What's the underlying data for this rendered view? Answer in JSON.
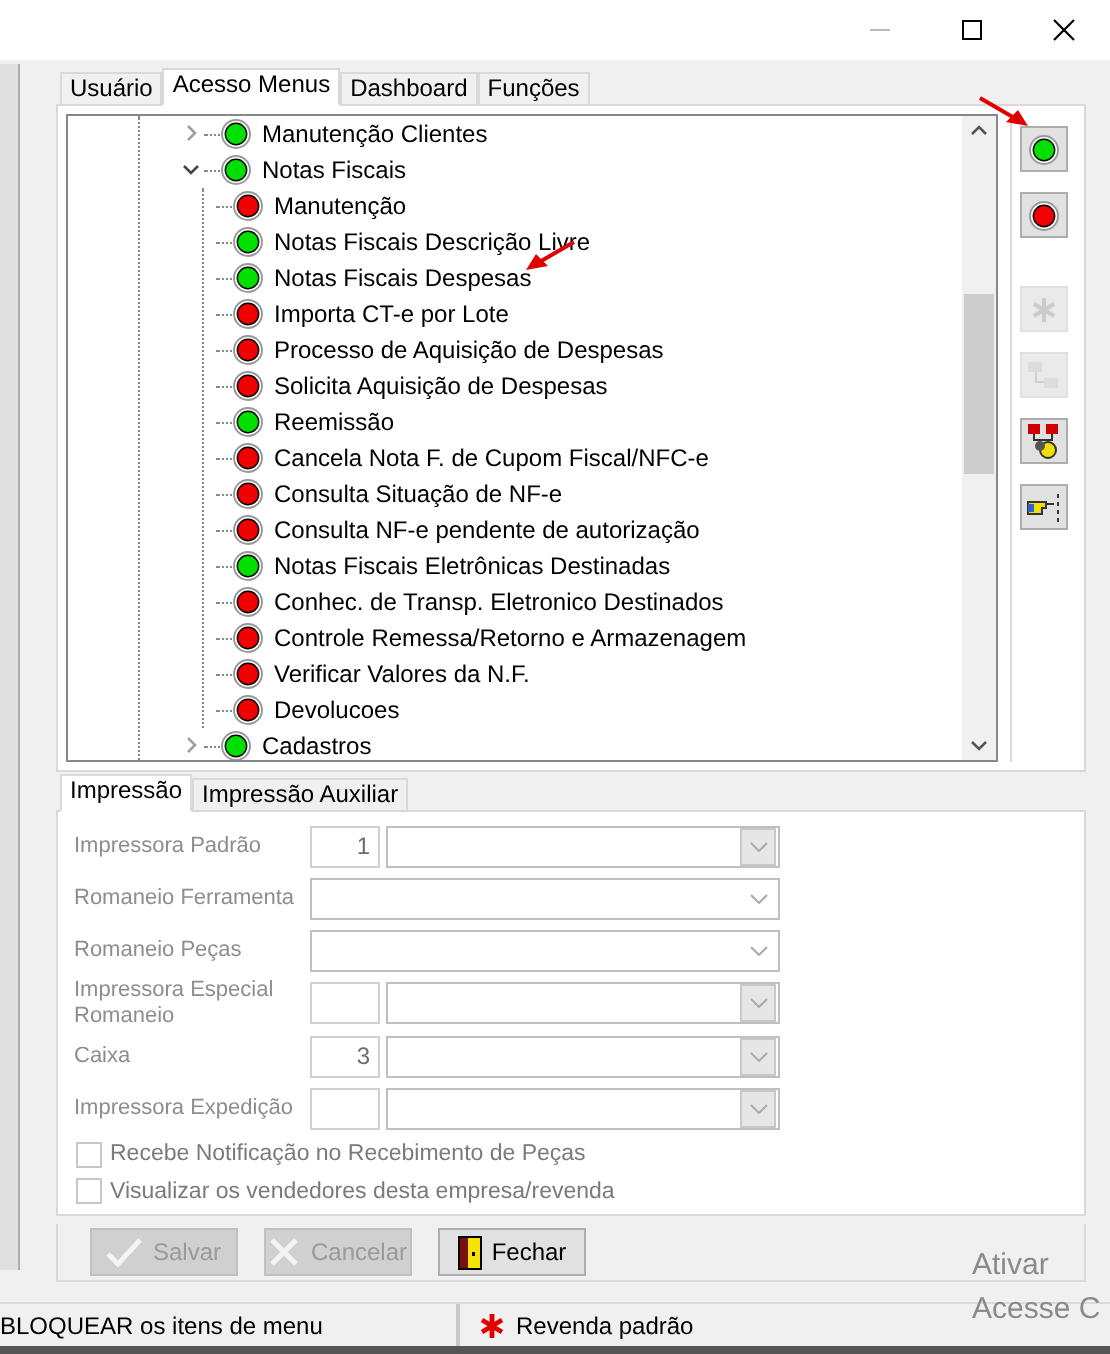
{
  "tabs": [
    {
      "label": "Usuário",
      "selected": false
    },
    {
      "label": "Acesso Menus",
      "selected": true
    },
    {
      "label": "Dashboard",
      "selected": false
    },
    {
      "label": "Funções",
      "selected": false
    }
  ],
  "tree": [
    {
      "label": "Manutenção Clientes",
      "on": true,
      "expanded": false
    },
    {
      "label": "Notas Fiscais",
      "on": true,
      "expanded": true,
      "children": [
        {
          "label": "Manutenção",
          "on": false
        },
        {
          "label": "Notas Fiscais Descrição Livre",
          "on": true
        },
        {
          "label": "Notas Fiscais Despesas",
          "on": true
        },
        {
          "label": "Importa CT-e por Lote",
          "on": false
        },
        {
          "label": "Processo de Aquisição de Despesas",
          "on": false
        },
        {
          "label": "Solicita Aquisição de Despesas",
          "on": false
        },
        {
          "label": "Reemissão",
          "on": true
        },
        {
          "label": "Cancela Nota F. de Cupom Fiscal/NFC-e",
          "on": false
        },
        {
          "label": "Consulta Situação de NF-e",
          "on": false
        },
        {
          "label": "Consulta NF-e pendente de autorização",
          "on": false
        },
        {
          "label": "Notas Fiscais Eletrônicas Destinadas",
          "on": true
        },
        {
          "label": "Conhec. de Transp. Eletronico Destinados",
          "on": false
        },
        {
          "label": "Controle Remessa/Retorno e Armazenagem",
          "on": false
        },
        {
          "label": "Verificar Valores da N.F.",
          "on": false
        },
        {
          "label": "Devolucoes",
          "on": false
        }
      ]
    },
    {
      "label": "Cadastros",
      "on": true,
      "expanded": false
    }
  ],
  "side_buttons": [
    {
      "kind": "allow",
      "disabled": false
    },
    {
      "kind": "block",
      "disabled": false
    },
    {
      "kind": "asterisk",
      "disabled": true
    },
    {
      "kind": "network",
      "disabled": true
    },
    {
      "kind": "network-user",
      "disabled": false
    },
    {
      "kind": "pointer",
      "disabled": false
    }
  ],
  "sub_tabs": [
    {
      "label": "Impressão",
      "selected": true
    },
    {
      "label": "Impressão Auxiliar",
      "selected": false
    }
  ],
  "fields": [
    {
      "label": "Impressora Padrão",
      "kind": "code-combo",
      "code": "1"
    },
    {
      "label": "Romaneio Ferramenta",
      "kind": "combo"
    },
    {
      "label": "Romaneio Peças",
      "kind": "combo"
    },
    {
      "label": "Impressora Especial Romaneio",
      "kind": "code-combo"
    },
    {
      "label": "Caixa",
      "kind": "code-combo",
      "code": "3"
    },
    {
      "label": "Impressora Expedição",
      "kind": "code-combo"
    }
  ],
  "checkboxes": [
    {
      "label": "Recebe Notificação no Recebimento de Peças",
      "checked": false
    },
    {
      "label": "Visualizar os vendedores desta empresa/revenda",
      "checked": false
    }
  ],
  "buttons": [
    {
      "label": "Salvar",
      "kind": "check",
      "disabled": true
    },
    {
      "label": "Cancelar",
      "kind": "cross",
      "disabled": true
    },
    {
      "label": "Fechar",
      "kind": "door",
      "disabled": false
    }
  ],
  "status_bar": [
    {
      "text": "BLOQUEAR os itens de menu"
    },
    {
      "text": "Revenda padrão",
      "kind": "asterisk"
    }
  ],
  "activation_notice": [
    "Ativar",
    "Acesse C"
  ]
}
